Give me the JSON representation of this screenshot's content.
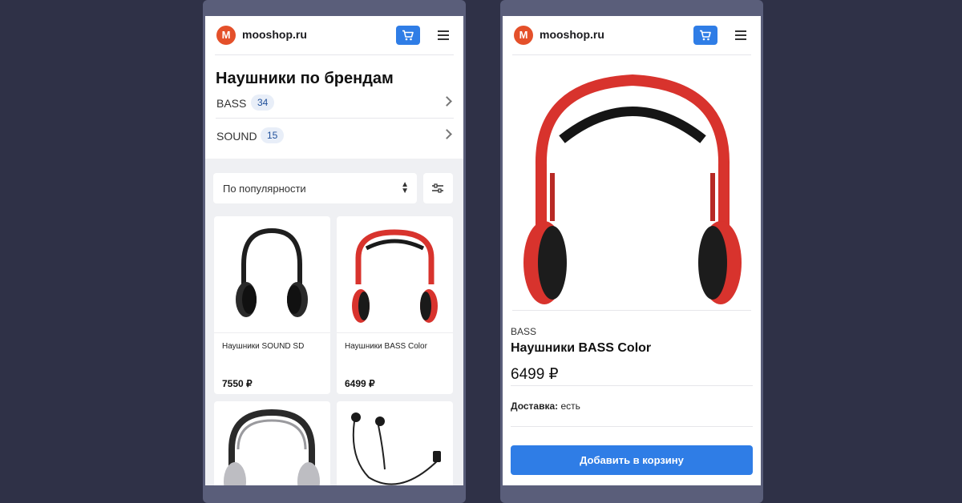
{
  "colors": {
    "page_bg": "#2f3147",
    "phone_frame": "#5a5e7a",
    "accent_blue": "#2f7de6",
    "logo_red": "#e4502a",
    "badge_bg": "#e8eef8",
    "catalog_bg": "#eff0f3"
  },
  "header": {
    "logo_letter": "M",
    "site_name": "mooshop.ru",
    "cart_icon": "cart-icon",
    "menu_icon": "hamburger-icon"
  },
  "left": {
    "title": "Наушники по брендам",
    "brands": [
      {
        "name": "BASS",
        "count": "34"
      },
      {
        "name": "SOUND",
        "count": "15"
      }
    ],
    "sort": {
      "label": "По популярности",
      "icon": "sort-arrows-icon"
    },
    "filter_icon": "sliders-icon",
    "products": [
      {
        "name": "Наушники SOUND SD",
        "price": "7550 ₽",
        "image": "black-headphones"
      },
      {
        "name": "Наушники BASS Color",
        "price": "6499 ₽",
        "image": "red-headphones"
      },
      {
        "name": "",
        "price": "",
        "image": "silver-headphones"
      },
      {
        "name": "",
        "price": "",
        "image": "black-earbuds"
      }
    ]
  },
  "right": {
    "brand": "BASS",
    "title": "Наушники BASS Color",
    "price": "6499 ₽",
    "delivery_label": "Доставка:",
    "delivery_value": "есть",
    "add_to_cart": "Добавить в корзину"
  }
}
